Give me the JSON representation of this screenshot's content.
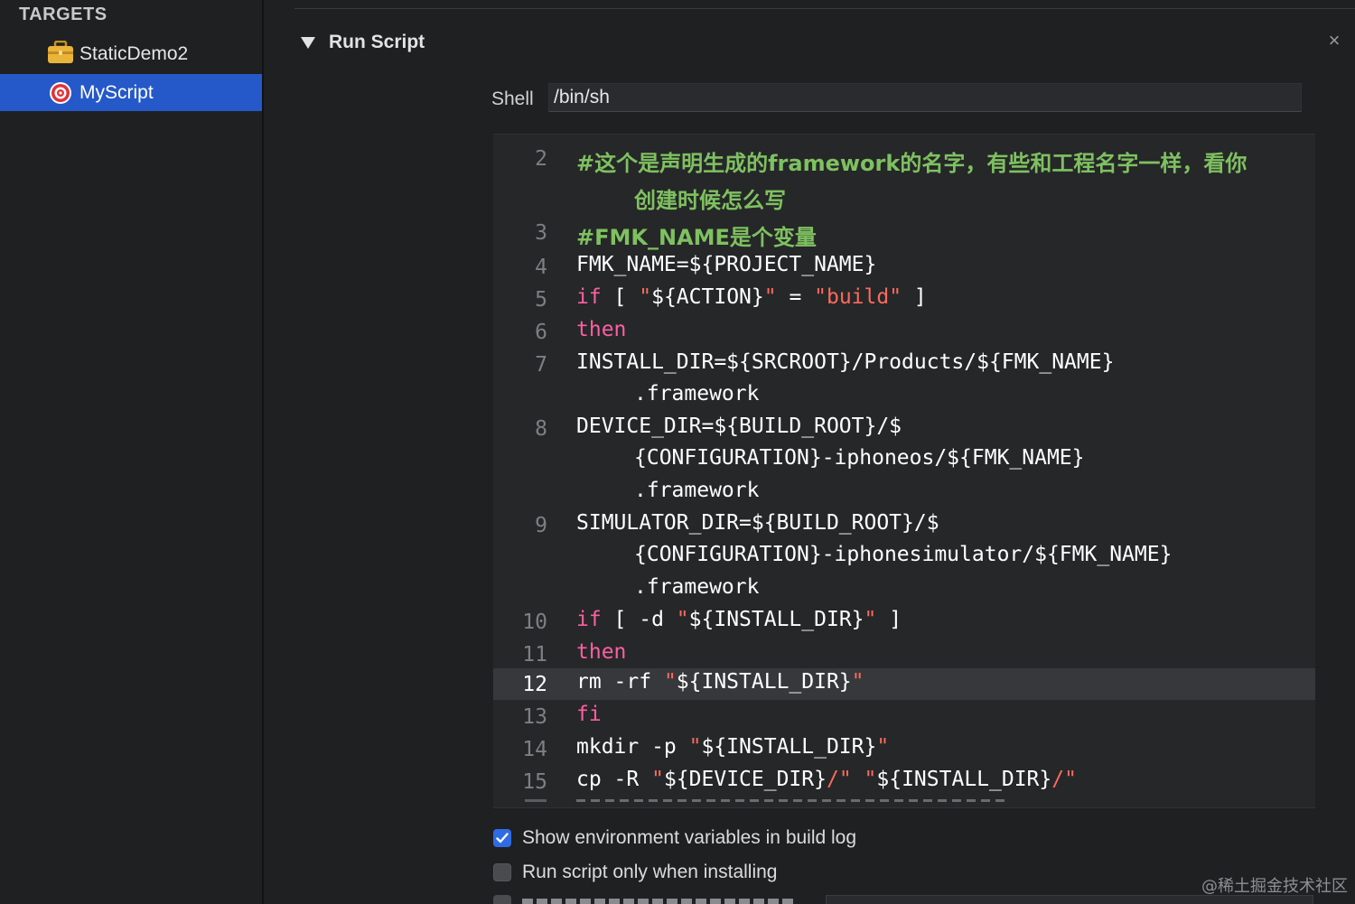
{
  "sidebar": {
    "title": "TARGETS",
    "items": [
      {
        "label": "StaticDemo2",
        "icon": "toolbox-icon",
        "selected": false
      },
      {
        "label": "MyScript",
        "icon": "target-icon",
        "selected": true
      }
    ]
  },
  "phase": {
    "title": "Run Script",
    "close_glyph": "×"
  },
  "shell": {
    "label": "Shell",
    "value": "/bin/sh"
  },
  "code": {
    "lines": [
      {
        "no": "2"
      },
      {
        "no": "3"
      },
      {
        "no": "4"
      },
      {
        "no": "5"
      },
      {
        "no": "6"
      },
      {
        "no": "7"
      },
      {
        "no": "8"
      },
      {
        "no": "9"
      },
      {
        "no": "10"
      },
      {
        "no": "11"
      },
      {
        "no": "12",
        "current": true
      },
      {
        "no": "13"
      },
      {
        "no": "14"
      },
      {
        "no": "15"
      }
    ],
    "texts": {
      "l2a": "#这个是声明生成的framework的名字，有些和工程名字一样，看你",
      "l2b": "创建时候怎么写",
      "l3": "#FMK_NAME是个变量",
      "l4": "FMK_NAME=${PROJECT_NAME}",
      "l5_if": "if",
      "l5_br": " [ ",
      "l5_q1": "\"",
      "l5_var": "${ACTION}",
      "l5_q2": "\"",
      "l5_eq": " = ",
      "l5_str": "\"build\"",
      "l5_end": " ]",
      "l6": "then",
      "l7a": "INSTALL_DIR=${SRCROOT}/Products/${FMK_NAME}",
      "l7b": ".framework",
      "l8a": "DEVICE_DIR=${BUILD_ROOT}/$",
      "l8b": "{CONFIGURATION}-iphoneos/${FMK_NAME}",
      "l8c": ".framework",
      "l9a": "SIMULATOR_DIR=${BUILD_ROOT}/$",
      "l9b": "{CONFIGURATION}-iphonesimulator/${FMK_NAME}",
      "l9c": ".framework",
      "l10_if": "if",
      "l10_mid": " [ -d ",
      "l10_q1": "\"",
      "l10_var": "${INSTALL_DIR}",
      "l10_q2": "\"",
      "l10_end": " ]",
      "l11": "then",
      "l12_cmd": "rm -rf ",
      "l12_q1": "\"",
      "l12_var": "${INSTALL_DIR}",
      "l12_q2": "\"",
      "l13": "fi",
      "l14_cmd": "mkdir -p ",
      "l14_q1": "\"",
      "l14_var": "${INSTALL_DIR}",
      "l14_q2": "\"",
      "l15_cmd": "cp -R ",
      "l15_q1": "\"",
      "l15_var1": "${DEVICE_DIR}",
      "l15_s1": "/\"",
      "l15_sp": " ",
      "l15_q3": "\"",
      "l15_var2": "${INSTALL_DIR}",
      "l15_s2": "/\""
    }
  },
  "options": {
    "show_env": {
      "label": "Show environment variables in build log",
      "checked": true
    },
    "install_only": {
      "label": "Run script only when installing",
      "checked": false
    }
  },
  "watermark": "@稀土掘金技术社区",
  "colors": {
    "selection": "#2559c9",
    "comment": "#7ec160",
    "keyword": "#fc5fa3",
    "string": "#fc6a5d",
    "checkbox_on": "#2f6be5"
  }
}
